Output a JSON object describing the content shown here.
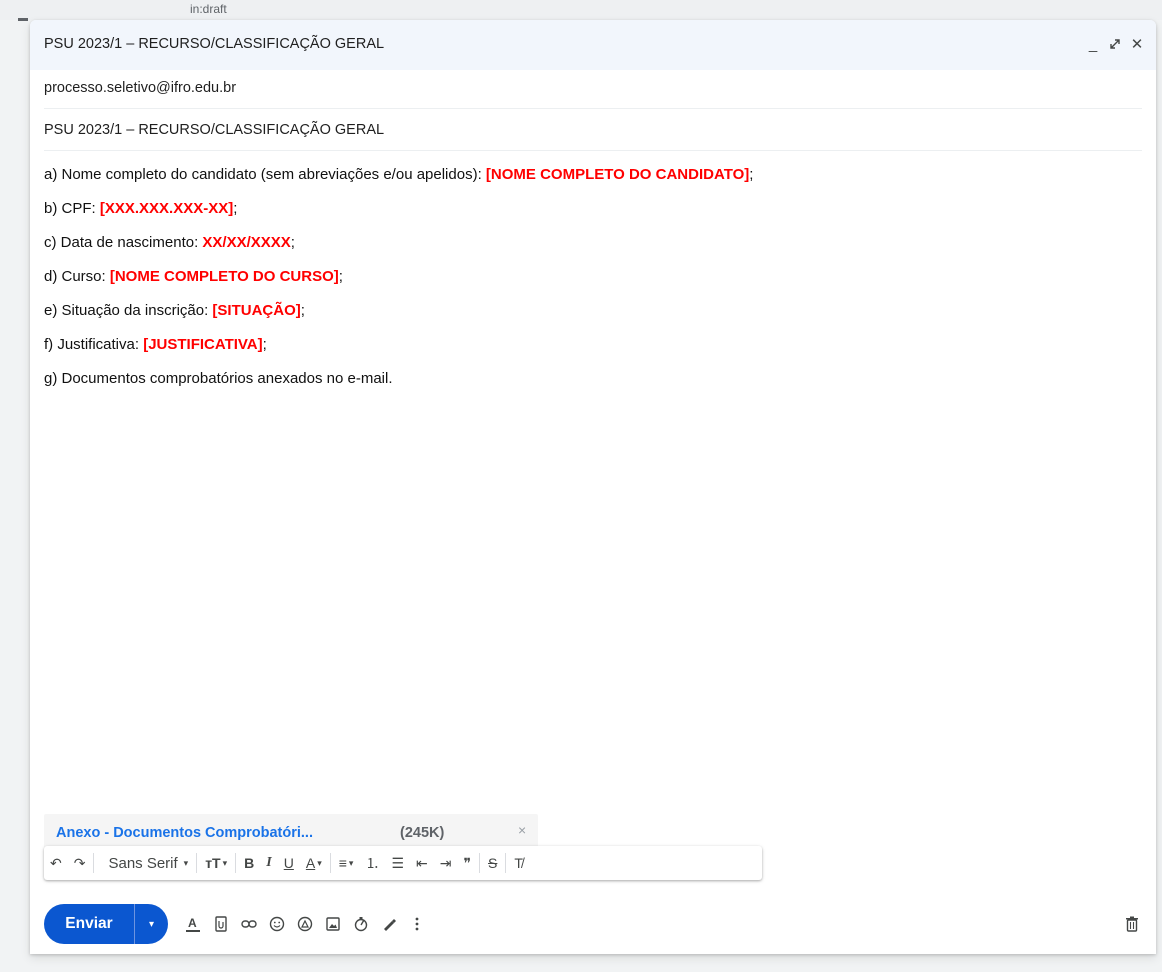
{
  "compose": {
    "title": "PSU 2023/1 – RECURSO/CLASSIFICAÇÃO GERAL",
    "to": "processo.seletivo@ifro.edu.br",
    "subject": "PSU 2023/1 – RECURSO/CLASSIFICAÇÃO GERAL",
    "window_buttons": {
      "minimize": "_",
      "expand": "⤢",
      "close": "✕"
    }
  },
  "body": {
    "line_a_prefix": "a) Nome completo do candidato (sem abreviações e/ou apelidos): ",
    "line_a_value": "[NOME COMPLETO DO CANDIDATO]",
    "line_a_suffix": ";",
    "line_b_prefix": "b) CPF: ",
    "line_b_value": "[XXX.XXX.XXX-XX]",
    "line_b_suffix": ";",
    "line_c_prefix": "c) Data de nascimento: ",
    "line_c_value": "XX/XX/XXXX",
    "line_c_suffix": ";",
    "line_d_prefix": "d) Curso: ",
    "line_d_value": "[NOME COMPLETO DO CURSO]",
    "line_d_suffix": ";",
    "line_e_prefix": "e) Situação da inscrição: ",
    "line_e_value": "[SITUAÇÃO]",
    "line_e_suffix": ";",
    "line_f_prefix": "f) Justificativa: ",
    "line_f_value": "[JUSTIFICATIVA]",
    "line_f_suffix": ";",
    "line_g": "g) Documentos comprobatórios anexados no e-mail."
  },
  "attachment": {
    "name": "Anexo - Documentos Comprobatóri...",
    "size": "(245K)",
    "close": "×"
  },
  "format_bar": {
    "undo": "↶",
    "redo": "↷",
    "font": "Sans Serif",
    "caret": "▾",
    "size": "тT",
    "bold": "B",
    "italic": "I",
    "underline": "U",
    "text_color": "A",
    "align": "≡",
    "numbered_list": "⒈",
    "bulleted_list": "☰",
    "indent_less": "⇤",
    "indent_more": "⇥",
    "quote": "❞",
    "strikethrough": "S",
    "remove_format": "T̸"
  },
  "bottom_bar": {
    "send": "Enviar",
    "send_more": "▾",
    "trash": "🗑"
  },
  "colors": {
    "accent": "#0b57d0",
    "highlight": "#ff0000",
    "attachment_link": "#1a73e8"
  }
}
